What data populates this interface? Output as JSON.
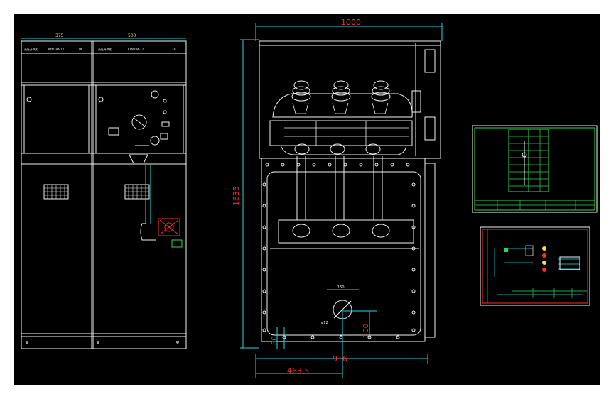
{
  "dimensions": {
    "width_total": "1000",
    "height_total": "1635",
    "base_width": "916",
    "offset_center": "463.5",
    "offset_left": "80",
    "hole_height": "300",
    "hole_diameter": "150",
    "hole_note": "φ12"
  },
  "front_view": {
    "width_left": "375",
    "width_right": "500"
  },
  "colors": {
    "background": "#000000",
    "line": "#f2f2f2",
    "dimension": "#27d8e6",
    "dimension_text": "#ff2a2a",
    "schematic": "#2fd84a"
  }
}
